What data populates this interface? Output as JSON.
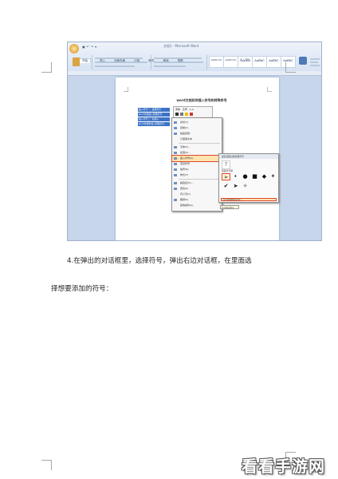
{
  "caption": {
    "line1": "4.在弹出的对话框里，选择符号，弹出右边对话框，在里面选",
    "line2": "择想要添加的符号："
  },
  "watermark": "看看手游网",
  "screenshot": {
    "window_title": "文档1 - Microsoft Word",
    "quick_access": "▣ ↶ ↷ ▾",
    "tabs": [
      "开始",
      "插入",
      "页面布局",
      "引用",
      "邮件",
      "审阅",
      "视图"
    ],
    "style_gallery": [
      "AaBbCcDc",
      "AaBbCcDc",
      "AaBb",
      "AaBbC",
      "AaBbC",
      "AaBbC"
    ],
    "document_title": "word文档如何插入符号和特殊符号",
    "selected_lines": [
      "插入符号一：选择符号",
      "word文档插入特殊符号",
      "插入符号二：在插入",
      "word文档中插入特殊符号"
    ],
    "mini_toolbar": "宋体 · 五号 · A A",
    "context_menu": {
      "items": [
        "剪切(T)",
        "复制(C)",
        "粘贴选项:",
        "只保留文本",
        "字体(F)...",
        "段落(P)...",
        "插入符号(S)",
        "项目符号",
        "编号(N)",
        "样式(T)",
        "超链接(H)...",
        "查找(K)",
        "同义词(Y)",
        "翻译(S)",
        "其他操作(A)"
      ],
      "highlighted_index": 6
    },
    "symbol_panel": {
      "header": "最近使用过的项目符号",
      "big_symbol": "?",
      "label": "项目符号库",
      "symbols": [
        "➢",
        "•",
        "●",
        "■",
        "◆",
        "❖",
        "✔",
        "➤",
        "✧"
      ],
      "selected_index": 0,
      "footer": "定义新项目符号(D)...",
      "tooltip": "定义新项目符号"
    }
  }
}
